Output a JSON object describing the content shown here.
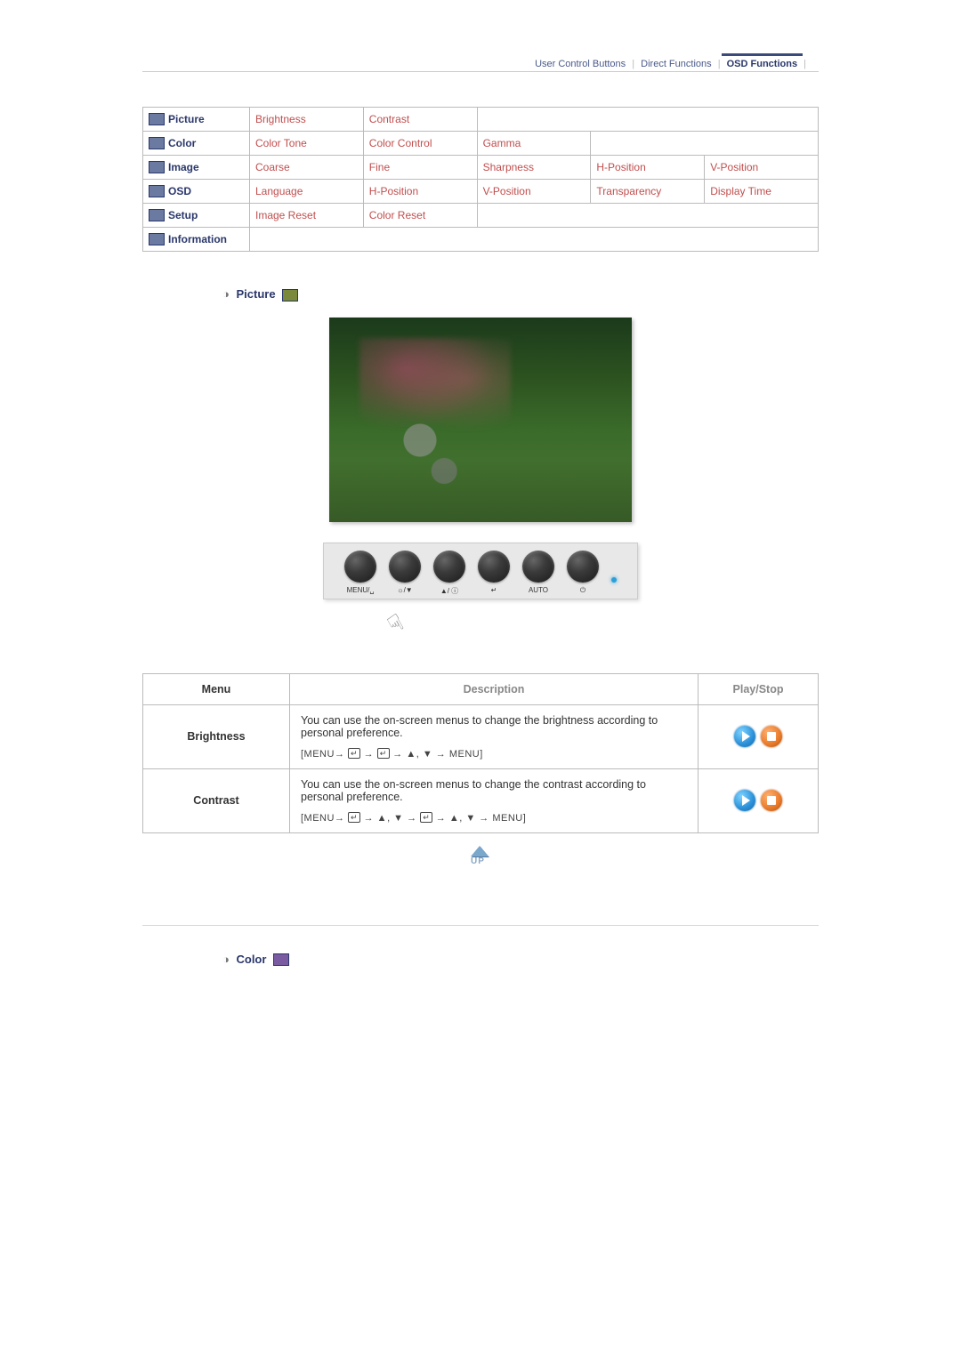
{
  "topnav": {
    "tab1": "User Control Buttons",
    "tab2": "Direct Functions",
    "tab3": "OSD Functions"
  },
  "grid": {
    "r0": {
      "c0": "Picture",
      "c1": "Brightness",
      "c2": "Contrast"
    },
    "r1": {
      "c0": "Color",
      "c1": "Color Tone",
      "c2": "Color Control",
      "c3": "Gamma"
    },
    "r2": {
      "c0": "Image",
      "c1": "Coarse",
      "c2": "Fine",
      "c3": "Sharpness",
      "c4": "H-Position",
      "c5": "V-Position"
    },
    "r3": {
      "c0": "OSD",
      "c1": "Language",
      "c2": "H-Position",
      "c3": "V-Position",
      "c4": "Transparency",
      "c5": "Display Time"
    },
    "r4": {
      "c0": "Setup",
      "c1": "Image Reset",
      "c2": "Color Reset"
    },
    "r5": {
      "c0": "Information"
    }
  },
  "section": {
    "picture": "Picture",
    "color": "Color"
  },
  "panel": {
    "b0": "MENU/␣",
    "b1": "☼/▼",
    "b2": "▲/ ⓘ",
    "b3": "↵",
    "b4": "AUTO",
    "b5": "⏻"
  },
  "desc": {
    "head": {
      "menu": "Menu",
      "description": "Description",
      "play": "Play/Stop"
    },
    "rows": [
      {
        "menu": "Brightness",
        "text": "You can use the on-screen menus to change the brightness according to personal preference.",
        "seq_prefix": "[MENU",
        "seq_suffix": "MENU]"
      },
      {
        "menu": "Contrast",
        "text": "You can use the on-screen menus to change the contrast according to personal preference.",
        "seq_prefix": "[MENU",
        "seq_suffix": "MENU]"
      }
    ]
  },
  "up": "UP"
}
